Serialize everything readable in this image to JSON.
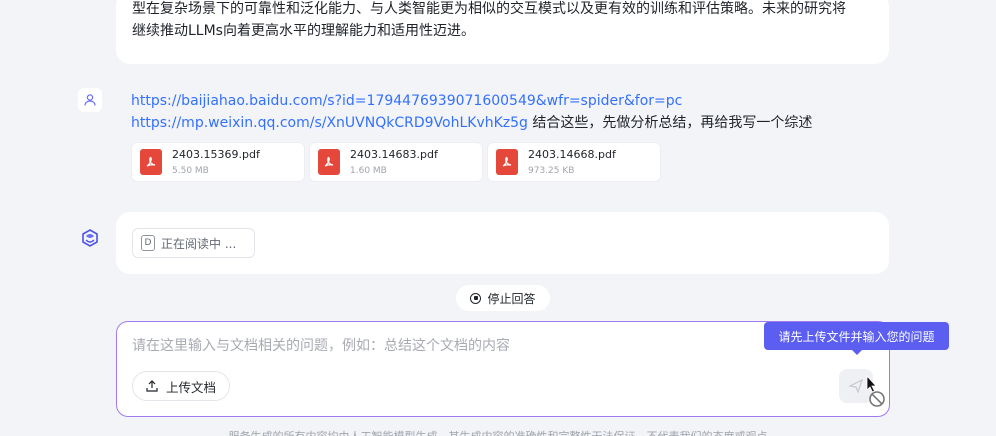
{
  "previous_answer": {
    "line1": "型在复杂场景下的可靠性和泛化能力、与人类智能更为相似的交互模式以及更有效的训练和评估策略。未来的研究将",
    "line2": "继续推动LLMs向着更高水平的理解能力和适用性迈进。"
  },
  "user_message": {
    "link1": "https://baijiahao.baidu.com/s?id=1794476939071600549&wfr=spider&for=pc",
    "link2": "https://mp.weixin.qq.com/s/XnUVNQkCRD9VohLKvhKz5g",
    "text": " 结合这些，先做分析总结，再给我写一个综述",
    "files": [
      {
        "name": "2403.15369.pdf",
        "size": "5.50 MB"
      },
      {
        "name": "2403.14683.pdf",
        "size": "1.60 MB"
      },
      {
        "name": "2403.14668.pdf",
        "size": "973.25 KB"
      }
    ]
  },
  "reading_status": "正在阅读中 ...",
  "stop_button": "停止回答",
  "input": {
    "placeholder": "请在这里输入与文档相关的问题，例如：总结这个文档的内容",
    "upload_label": "上传文档"
  },
  "tooltip": "请先上传文件并输入您的问题",
  "disclaimer": "服务生成的所有内容均由人工智能模型生成，其生成内容的准确性和完整性无法保证，不代表我们的态度或观点",
  "colors": {
    "accent": "#5b5ef0",
    "link": "#3370ff",
    "input_border": "#a07bf0",
    "pdf": "#e5483a"
  },
  "icons": [
    "user-icon",
    "bot-logo-icon",
    "pdf-file-icon",
    "document-icon",
    "stop-icon",
    "upload-icon",
    "send-icon",
    "cursor-icon"
  ]
}
